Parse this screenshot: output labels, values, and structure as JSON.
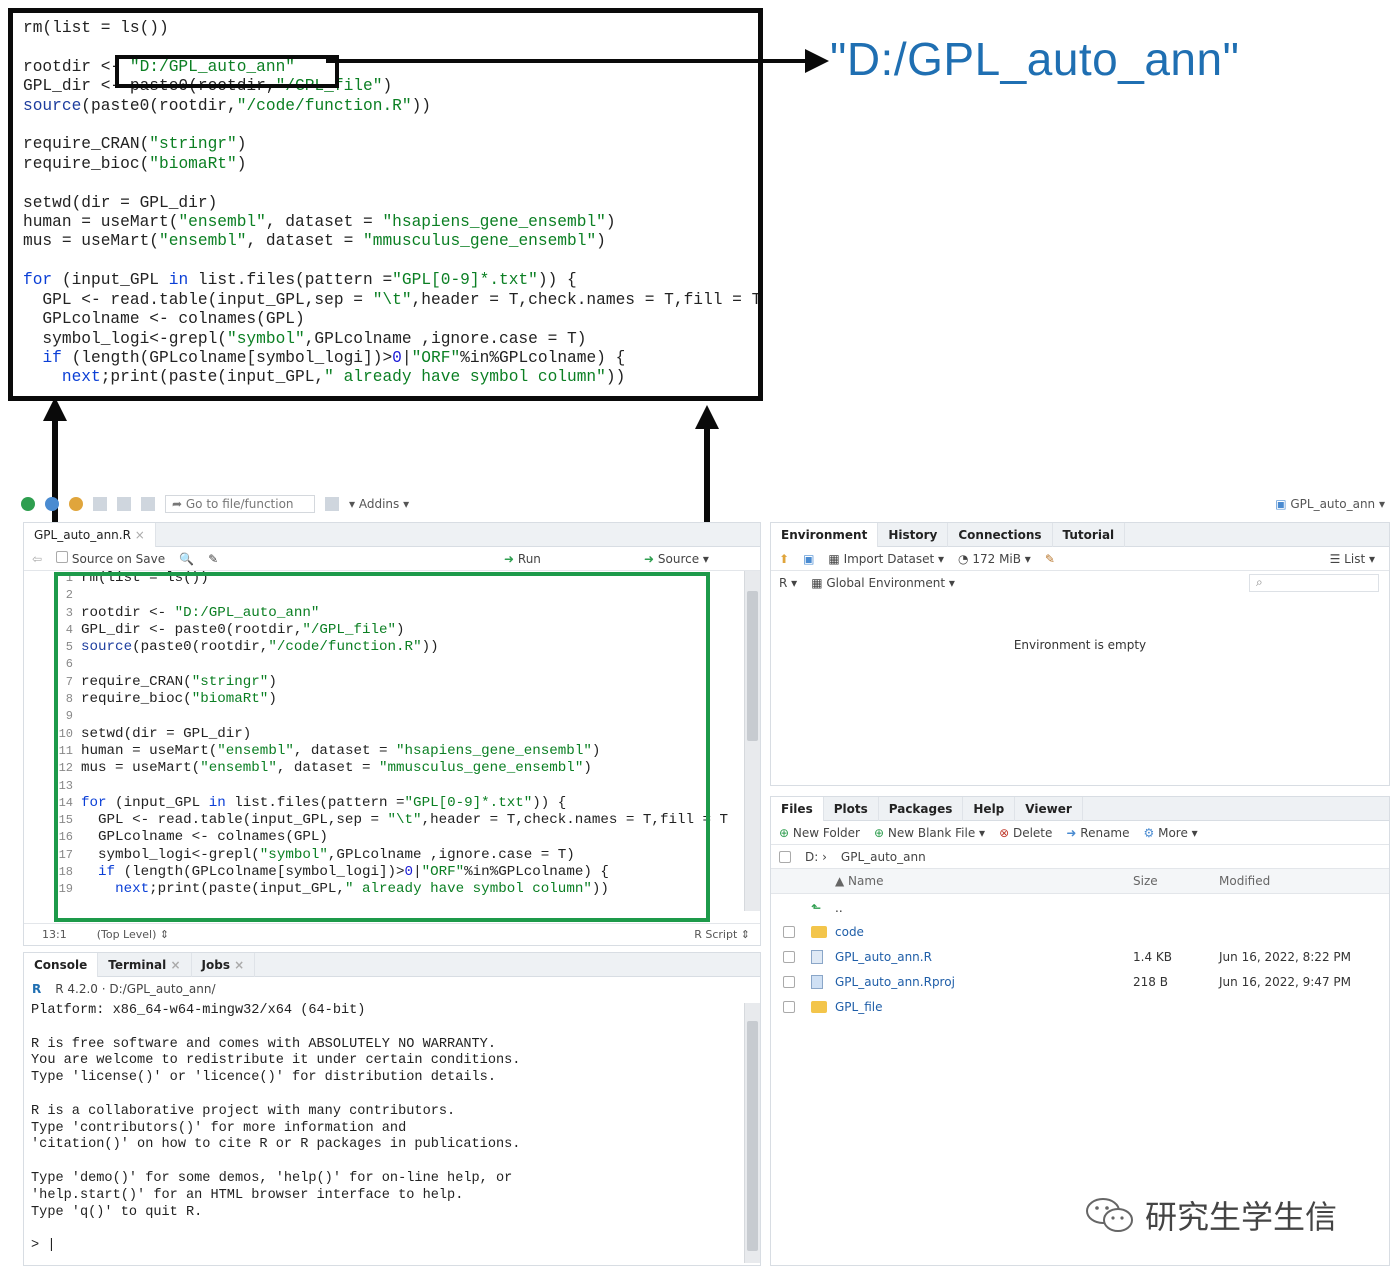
{
  "callout": {
    "code_lines": [
      "rm(list = ls())",
      "",
      "rootdir <- \"D:/GPL_auto_ann\"",
      "GPL_dir <- paste0(rootdir,\"/GPL_file\")",
      "source(paste0(rootdir,\"/code/function.R\"))",
      "",
      "require_CRAN(\"stringr\")",
      "require_bioc(\"biomaRt\")",
      "",
      "setwd(dir = GPL_dir)",
      "human = useMart(\"ensembl\", dataset = \"hsapiens_gene_ensembl\")",
      "mus = useMart(\"ensembl\", dataset = \"mmusculus_gene_ensembl\")",
      "",
      "for (input_GPL in list.files(pattern =\"GPL[0-9]*.txt\")) {",
      "  GPL <- read.table(input_GPL,sep = \"\\t\",header = T,check.names = T,fill = T",
      "  GPLcolname <- colnames(GPL)",
      "  symbol_logi<-grepl(\"symbol\",GPLcolname ,ignore.case = T)",
      "  if (length(GPLcolname[symbol_logi])>0|\"ORF\"%in%GPLcolname) {",
      "    next;print(paste(input_GPL,\" already have symbol column\"))"
    ],
    "highlight_label": "\"D:/GPL_auto_ann\""
  },
  "toolbar": {
    "goto_placeholder": "Go to file/function",
    "addins_label": "Addins",
    "project_label": "GPL_auto_ann"
  },
  "editor": {
    "tab_label": "GPL_auto_ann.R",
    "source_on_save": "Source on Save",
    "run_label": "Run",
    "source_label": "Source",
    "status_pos": "13:1",
    "status_scope": "(Top Level)",
    "status_type": "R Script",
    "line_numbers": [
      "1",
      "2",
      "3",
      "4",
      "5",
      "6",
      "7",
      "8",
      "9",
      "10",
      "11",
      "12",
      "13",
      "14",
      "15",
      "16",
      "17",
      "18",
      "19"
    ]
  },
  "console": {
    "tabs": [
      "Console",
      "Terminal",
      "Jobs"
    ],
    "version_line": "R 4.2.0 · D:/GPL_auto_ann/",
    "lines": [
      "Platform: x86_64-w64-mingw32/x64 (64-bit)",
      "",
      "R is free software and comes with ABSOLUTELY NO WARRANTY.",
      "You are welcome to redistribute it under certain conditions.",
      "Type 'license()' or 'licence()' for distribution details.",
      "",
      "R is a collaborative project with many contributors.",
      "Type 'contributors()' for more information and",
      "'citation()' on how to cite R or R packages in publications.",
      "",
      "Type 'demo()' for some demos, 'help()' for on-line help, or",
      "'help.start()' for an HTML browser interface to help.",
      "Type 'q()' to quit R.",
      "",
      "> |"
    ]
  },
  "environment": {
    "tabs": [
      "Environment",
      "History",
      "Connections",
      "Tutorial"
    ],
    "import_dataset": "Import Dataset",
    "memory": "172 MiB",
    "list_label": "List",
    "r_label": "R",
    "global_env": "Global Environment",
    "empty_message": "Environment is empty"
  },
  "files": {
    "tabs": [
      "Files",
      "Plots",
      "Packages",
      "Help",
      "Viewer"
    ],
    "actions": [
      "New Folder",
      "New Blank File",
      "Delete",
      "Rename",
      "More"
    ],
    "path_root": "D:",
    "path_folder": "GPL_auto_ann",
    "columns": [
      "Name",
      "Size",
      "Modified"
    ],
    "parent_label": "..",
    "rows": [
      {
        "name": "code",
        "size": "",
        "modified": ""
      },
      {
        "name": "GPL_auto_ann.R",
        "size": "1.4 KB",
        "modified": "Jun 16, 2022, 8:22 PM"
      },
      {
        "name": "GPL_auto_ann.Rproj",
        "size": "218 B",
        "modified": "Jun 16, 2022, 9:47 PM"
      },
      {
        "name": "GPL_file",
        "size": "",
        "modified": ""
      }
    ]
  },
  "watermark": {
    "text": "研究生学生信"
  }
}
